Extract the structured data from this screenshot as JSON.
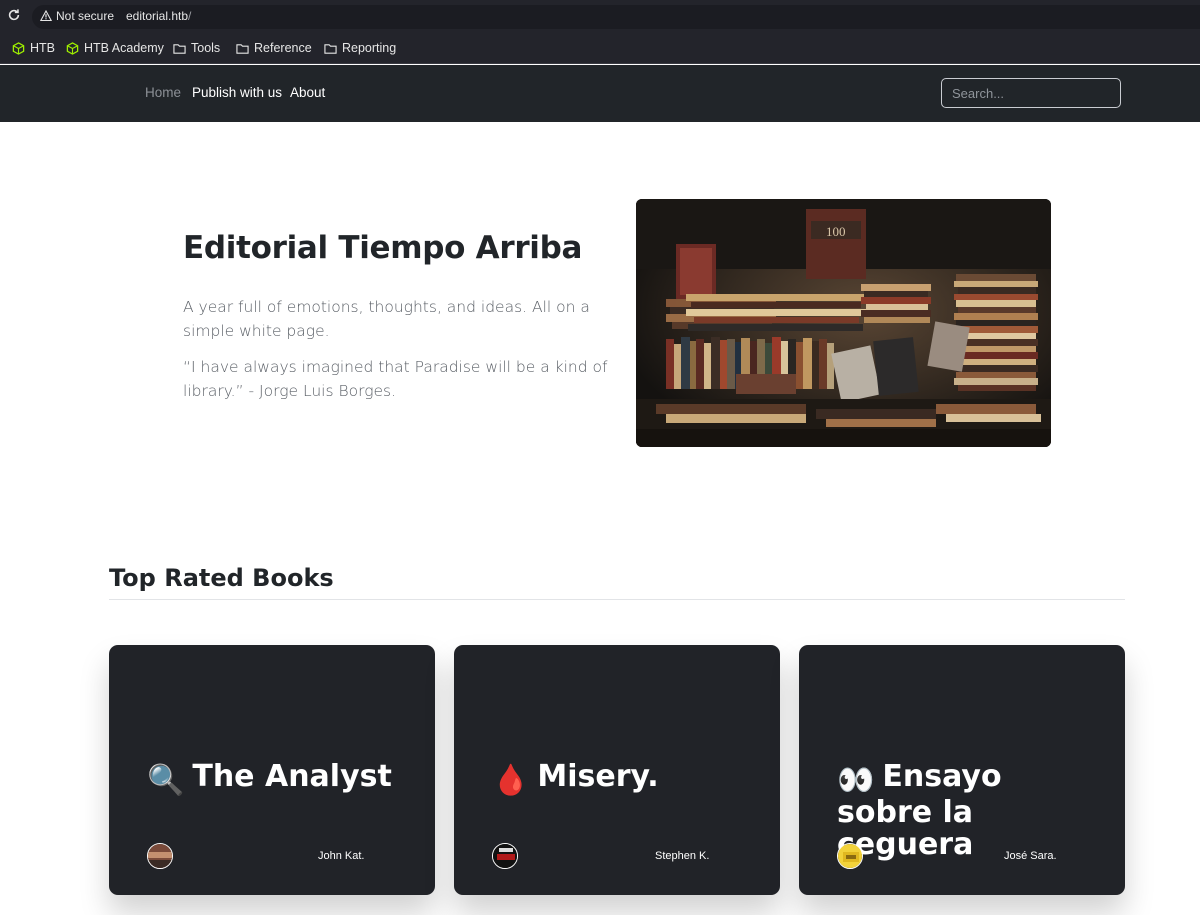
{
  "browser": {
    "security_label": "Not secure",
    "url_host": "editorial.htb",
    "url_path": "/",
    "bookmarks": [
      {
        "label": "HTB",
        "icon": "cube-icon"
      },
      {
        "label": "HTB Academy",
        "icon": "cube-icon"
      },
      {
        "label": "Tools",
        "icon": "folder-icon"
      },
      {
        "label": "Reference",
        "icon": "folder-icon"
      },
      {
        "label": "Reporting",
        "icon": "folder-icon"
      }
    ]
  },
  "nav": {
    "links": [
      "Home",
      "Publish with us",
      "About"
    ],
    "search_placeholder": "Search..."
  },
  "hero": {
    "title": "Editorial Tiempo Arriba",
    "paragraph1": "A year full of emotions, thoughts, and ideas. All on a simple white page.",
    "paragraph2": "“I have always imagined that Paradise will be a kind of library.” - Jorge Luis Borges.",
    "image_text": "100"
  },
  "section": {
    "title": "Top Rated Books"
  },
  "books": [
    {
      "emoji": "🔍",
      "title": "The Analyst",
      "author": "John Kat."
    },
    {
      "emoji": "🩸",
      "title": "Misery.",
      "author": "Stephen K."
    },
    {
      "emoji": "👀",
      "title": "Ensayo sobre la ceguera",
      "author": "José Sara."
    }
  ],
  "colors": {
    "nav_bg": "#212529",
    "card_bg": "#212328",
    "htb_green": "#9fef00"
  }
}
